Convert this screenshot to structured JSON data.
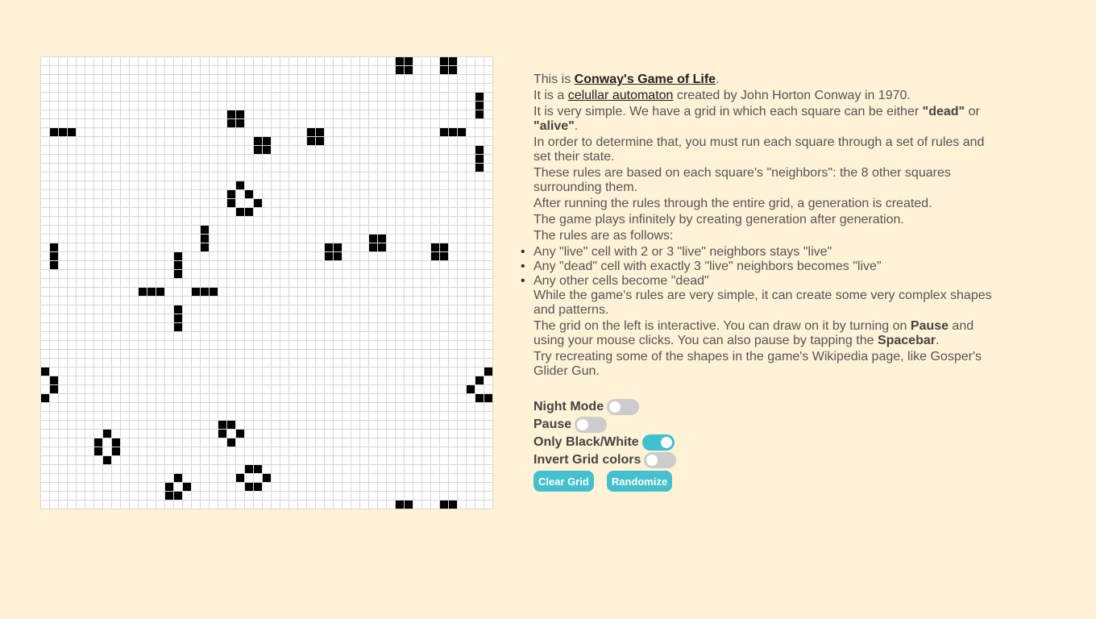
{
  "intro": {
    "p1_pre": "This is ",
    "p1_link": "Conway's Game of Life",
    "p1_post": ".",
    "p2_pre": "It is a ",
    "p2_link": "celullar automaton",
    "p2_post": " created by John Horton Conway in 1970.",
    "p3_pre": "It is very simple. We have a grid in which each square can be either ",
    "p3_dead": "\"dead\"",
    "p3_mid": " or ",
    "p3_alive": "\"alive\"",
    "p3_post": ".",
    "p4": "In order to determine that, you must run each square through a set of rules and set their state.",
    "p5": "These rules are based on each square's \"neighbors\": the 8 other squares surrounding them.",
    "p6": "After running the rules through the entire grid, a generation is created.",
    "p7": "The game plays infinitely by creating generation after generation.",
    "p8": "The rules are as follows:",
    "rules": [
      "Any \"live\" cell with 2 or 3 \"live\" neighbors stays \"live\"",
      "Any \"dead\" cell with exactly 3 \"live\" neighbors becomes \"live\"",
      "Any other cells become \"dead\""
    ],
    "p9": "While the game's rules are very simple, it can create some very complex shapes and patterns.",
    "p10_pre": "The grid on the left is interactive. You can draw on it by turning on ",
    "p10_pause": "Pause",
    "p10_mid": " and using your mouse clicks. You can also pause by tapping the ",
    "p10_space": "Spacebar",
    "p10_post": ".",
    "p11": "Try recreating some of the shapes in the game's Wikipedia page, like Gosper's Glider Gun."
  },
  "controls": [
    {
      "label": "Night Mode",
      "on": false
    },
    {
      "label": "Pause",
      "on": false
    },
    {
      "label": "Only Black/White",
      "on": true
    },
    {
      "label": "Invert Grid colors",
      "on": false
    }
  ],
  "buttons": {
    "clear": "Clear Grid",
    "randomize": "Randomize"
  },
  "grid": {
    "cols": 51,
    "rows": 51,
    "alive_cells": [
      [
        0,
        40
      ],
      [
        0,
        41
      ],
      [
        0,
        45
      ],
      [
        0,
        46
      ],
      [
        1,
        40
      ],
      [
        1,
        41
      ],
      [
        1,
        45
      ],
      [
        1,
        46
      ],
      [
        4,
        49
      ],
      [
        5,
        49
      ],
      [
        6,
        49
      ],
      [
        6,
        21
      ],
      [
        6,
        22
      ],
      [
        7,
        21
      ],
      [
        7,
        22
      ],
      [
        8,
        1
      ],
      [
        8,
        2
      ],
      [
        8,
        3
      ],
      [
        8,
        30
      ],
      [
        8,
        31
      ],
      [
        8,
        45
      ],
      [
        8,
        46
      ],
      [
        8,
        47
      ],
      [
        9,
        24
      ],
      [
        9,
        25
      ],
      [
        9,
        30
      ],
      [
        9,
        31
      ],
      [
        10,
        24
      ],
      [
        10,
        25
      ],
      [
        10,
        49
      ],
      [
        11,
        49
      ],
      [
        12,
        49
      ],
      [
        14,
        22
      ],
      [
        15,
        21
      ],
      [
        15,
        23
      ],
      [
        16,
        21
      ],
      [
        16,
        24
      ],
      [
        17,
        22
      ],
      [
        17,
        23
      ],
      [
        19,
        18
      ],
      [
        20,
        18
      ],
      [
        21,
        18
      ],
      [
        20,
        37
      ],
      [
        20,
        38
      ],
      [
        21,
        37
      ],
      [
        21,
        38
      ],
      [
        21,
        1
      ],
      [
        22,
        1
      ],
      [
        23,
        1
      ],
      [
        21,
        32
      ],
      [
        21,
        33
      ],
      [
        22,
        32
      ],
      [
        22,
        33
      ],
      [
        21,
        44
      ],
      [
        21,
        45
      ],
      [
        22,
        44
      ],
      [
        22,
        45
      ],
      [
        22,
        15
      ],
      [
        23,
        15
      ],
      [
        24,
        15
      ],
      [
        26,
        11
      ],
      [
        26,
        12
      ],
      [
        26,
        13
      ],
      [
        26,
        17
      ],
      [
        26,
        18
      ],
      [
        26,
        19
      ],
      [
        28,
        15
      ],
      [
        29,
        15
      ],
      [
        30,
        15
      ],
      [
        35,
        0
      ],
      [
        36,
        1
      ],
      [
        37,
        1
      ],
      [
        38,
        0
      ],
      [
        35,
        50
      ],
      [
        36,
        49
      ],
      [
        37,
        48
      ],
      [
        38,
        49
      ],
      [
        38,
        50
      ],
      [
        41,
        20
      ],
      [
        41,
        21
      ],
      [
        42,
        20
      ],
      [
        42,
        22
      ],
      [
        43,
        21
      ],
      [
        42,
        7
      ],
      [
        43,
        6
      ],
      [
        43,
        8
      ],
      [
        44,
        6
      ],
      [
        44,
        8
      ],
      [
        45,
        7
      ],
      [
        46,
        23
      ],
      [
        46,
        24
      ],
      [
        47,
        22
      ],
      [
        47,
        25
      ],
      [
        48,
        23
      ],
      [
        48,
        24
      ],
      [
        47,
        15
      ],
      [
        48,
        14
      ],
      [
        48,
        16
      ],
      [
        49,
        14
      ],
      [
        49,
        15
      ],
      [
        50,
        40
      ],
      [
        50,
        41
      ],
      [
        50,
        45
      ],
      [
        50,
        46
      ]
    ]
  }
}
